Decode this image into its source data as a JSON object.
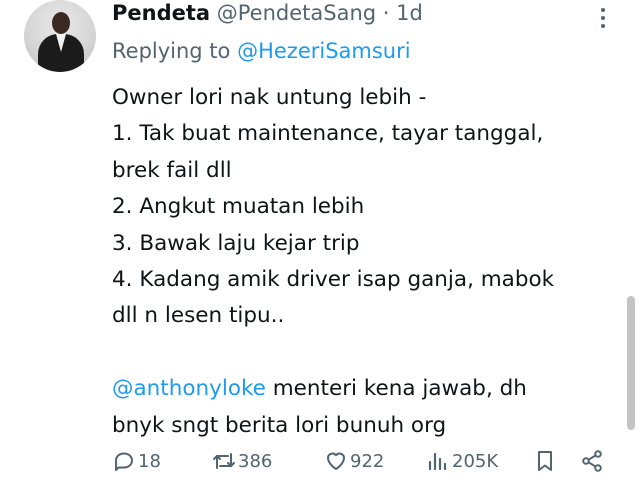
{
  "author": {
    "display_name": "Pendeta",
    "handle": "@PendetaSang",
    "separator": "·",
    "time": "1d"
  },
  "reply": {
    "prefix": "Replying to",
    "target": "@HezeriSamsuri"
  },
  "tweet": {
    "lines": [
      "Owner lori nak untung lebih -",
      "1. Tak buat maintenance, tayar tanggal,",
      "brek fail dll",
      "2.  Angkut muatan lebih",
      "3.  Bawak laju kejar trip",
      "4.  Kadang amik driver isap ganja, mabok",
      "dll n lesen tipu.."
    ],
    "mention": "@anthonyloke",
    "mention_rest": " menteri kena jawab, dh",
    "last_line": "bnyk sngt berita lori bunuh org"
  },
  "actions": {
    "replies": "18",
    "reposts": "386",
    "likes": "922",
    "views": "205K"
  },
  "icons": {
    "more": "more-vertical-icon",
    "reply": "reply-bubble-icon",
    "repost": "repost-icon",
    "like": "heart-icon",
    "views": "views-bar-chart-icon",
    "bookmark": "bookmark-icon",
    "share": "share-icon"
  },
  "colors": {
    "text": "#0f1419",
    "muted": "#536471",
    "link": "#1d9bf0"
  }
}
